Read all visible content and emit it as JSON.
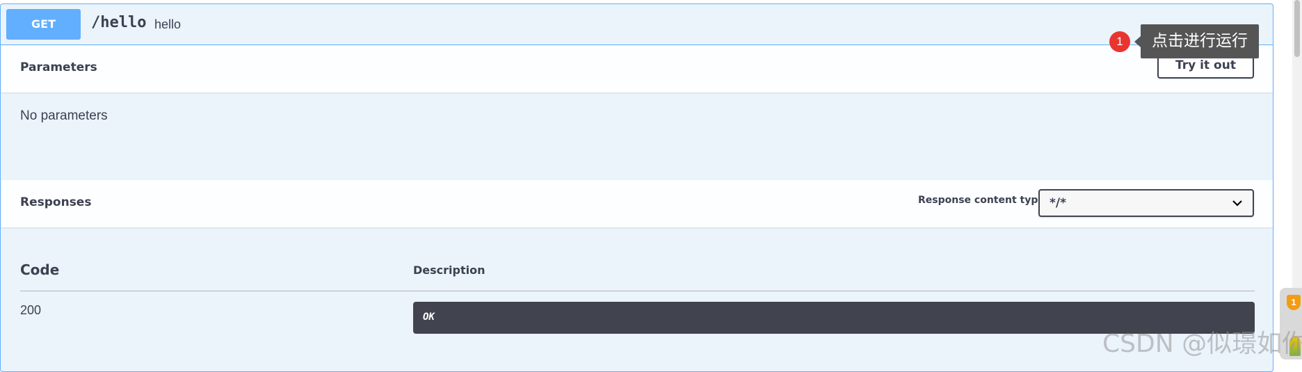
{
  "operation": {
    "method": "GET",
    "path": "/hello",
    "summary": "hello"
  },
  "parameters": {
    "title": "Parameters",
    "try_button": "Try it out",
    "empty_text": "No parameters"
  },
  "responses": {
    "title": "Responses",
    "content_type_label": "Response content type",
    "content_type_value": "*/*",
    "columns": {
      "code": "Code",
      "description": "Description"
    },
    "rows": [
      {
        "code": "200",
        "description": "OK"
      }
    ]
  },
  "tooltip": {
    "step": "1",
    "text": "点击进行运行"
  },
  "side_badge": "1",
  "watermark": "CSDN @似璟如你",
  "colors": {
    "get_method": "#61affe",
    "block_bg": "#ebf3fb",
    "dark_box": "#41444e",
    "tooltip_bg": "#555555",
    "step_badge": "#e8352f"
  }
}
